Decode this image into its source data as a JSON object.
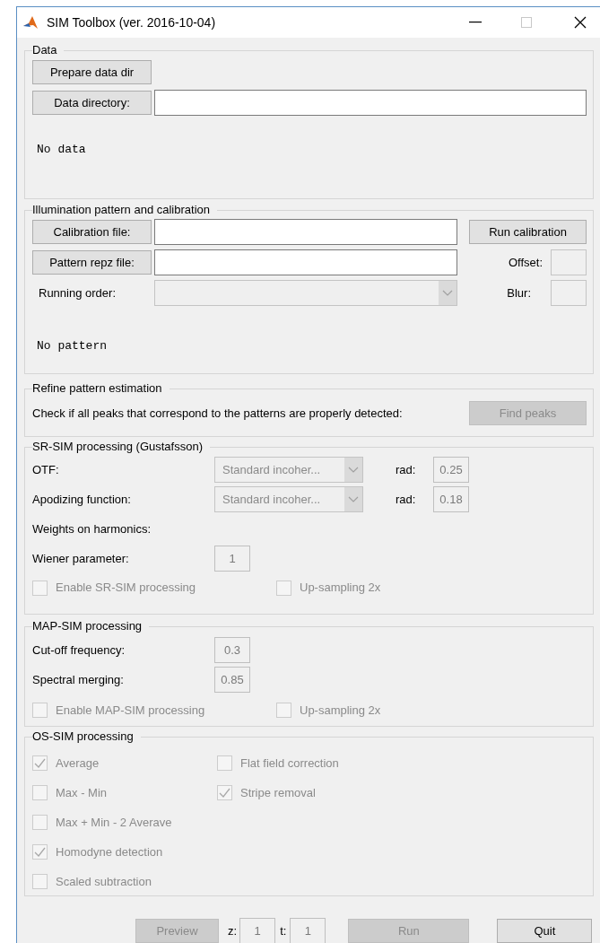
{
  "window": {
    "title": "SIM Toolbox (ver. 2016-10-04)"
  },
  "data": {
    "title": "Data",
    "prepare_button": {
      "label": "Prepare data dir",
      "disabled": false
    },
    "directory_button": {
      "label": "Data directory:",
      "disabled": false
    },
    "status": "No data"
  },
  "illumination": {
    "title": "Illumination pattern and calibration",
    "calibration_button": {
      "label": "Calibration file:",
      "disabled": false
    },
    "run_calibration_button": {
      "label": "Run calibration",
      "disabled": false
    },
    "pattern_button": {
      "label": "Pattern repz file:",
      "disabled": false
    },
    "offset_label": "Offset:",
    "running_order_label": "Running order:",
    "running_order": {
      "disabled": true
    },
    "blur_label": "Blur:",
    "status": "No pattern"
  },
  "refine": {
    "title": "Refine pattern estimation",
    "text": "Check if all peaks that correspond to the patterns are properly detected:",
    "find_peaks_button": {
      "label": "Find peaks",
      "disabled": true
    }
  },
  "sr_sim": {
    "title": "SR-SIM processing (Gustafsson)",
    "rows": [
      {
        "label": "OTF:",
        "select": {
          "value": "Standard incoher...",
          "disabled": true
        },
        "rad_label": "rad:",
        "rad": {
          "value": "0.25",
          "disabled": true
        }
      },
      {
        "label": "Apodizing function:",
        "select": {
          "value": "Standard incoher...",
          "disabled": true
        },
        "rad_label": "rad:",
        "rad": {
          "value": "0.18",
          "disabled": true
        }
      }
    ],
    "weights_label": "Weights on harmonics:",
    "wiener_label": "Wiener parameter:",
    "wiener": {
      "value": "1",
      "disabled": true
    },
    "checkboxes": [
      {
        "label": "Enable SR-SIM processing",
        "checked": false,
        "disabled": true
      },
      {
        "label": "Up-sampling 2x",
        "checked": false,
        "disabled": true
      }
    ]
  },
  "map_sim": {
    "title": "MAP-SIM processing",
    "fields": [
      {
        "label": "Cut-off frequency:",
        "value": "0.3",
        "disabled": true
      },
      {
        "label": "Spectral merging:",
        "value": "0.85",
        "disabled": true
      }
    ],
    "checkboxes": [
      {
        "label": "Enable MAP-SIM processing",
        "checked": false,
        "disabled": true
      },
      {
        "label": "Up-sampling 2x",
        "checked": false,
        "disabled": true
      }
    ]
  },
  "os_sim": {
    "title": "OS-SIM processing",
    "column_1": [
      {
        "label": "Average",
        "checked": true,
        "disabled": true
      },
      {
        "label": "Max - Min",
        "checked": false,
        "disabled": true
      },
      {
        "label": "Max + Min - 2 Averave",
        "checked": false,
        "disabled": true
      },
      {
        "label": "Homodyne detection",
        "checked": true,
        "disabled": true
      },
      {
        "label": "Scaled subtraction",
        "checked": false,
        "disabled": true
      }
    ],
    "column_2": [
      {
        "label": "Flat field correction",
        "checked": false,
        "disabled": true
      },
      {
        "label": "Stripe removal",
        "checked": true,
        "disabled": true
      }
    ]
  },
  "footer": {
    "preview_button": {
      "label": "Preview",
      "disabled": true
    },
    "z_label": "z:",
    "z": {
      "value": "1",
      "disabled": true
    },
    "t_label": "t:",
    "t": {
      "value": "1",
      "disabled": true
    },
    "run_button": {
      "label": "Run",
      "disabled": true
    },
    "quit_button": {
      "label": "Quit",
      "disabled": false
    }
  }
}
